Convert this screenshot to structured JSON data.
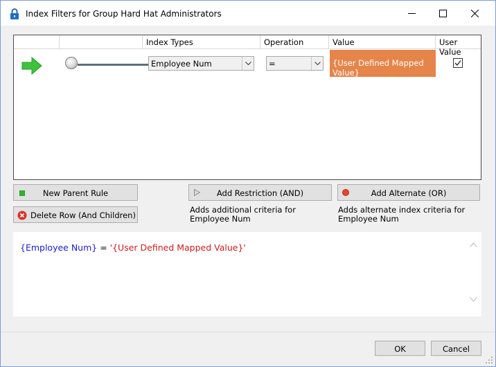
{
  "window": {
    "title": "Index Filters for Group Hard Hat Administrators",
    "minimize_glyph": "—",
    "maximize_glyph": "☐",
    "close_glyph": "✕"
  },
  "grid": {
    "columns": [
      "Index Types",
      "Operation",
      "Value",
      "User Value"
    ],
    "row": {
      "index_type": "Employee Num",
      "operation": "=",
      "value": "{User Defined Mapped Value}",
      "user_value_checked": true
    },
    "value_cell_color": "#e5854a"
  },
  "buttons": {
    "new_parent_rule": "New Parent Rule",
    "delete_row": "Delete Row (And Children)",
    "add_restriction": "Add Restriction (AND)",
    "add_alternate": "Add Alternate (OR)",
    "ok": "OK",
    "cancel": "Cancel"
  },
  "help": {
    "restriction": "Adds additional criteria for Employee Num",
    "alternate": "Adds alternate index criteria for Employee Num"
  },
  "expression": {
    "field": "{Employee Num}",
    "operator": " = ",
    "value": "'{User Defined Mapped Value}'"
  },
  "colors": {
    "field_blue": "#1a1ad1",
    "value_red": "#cc1d1d",
    "arrow_green": "#3ec23e"
  }
}
